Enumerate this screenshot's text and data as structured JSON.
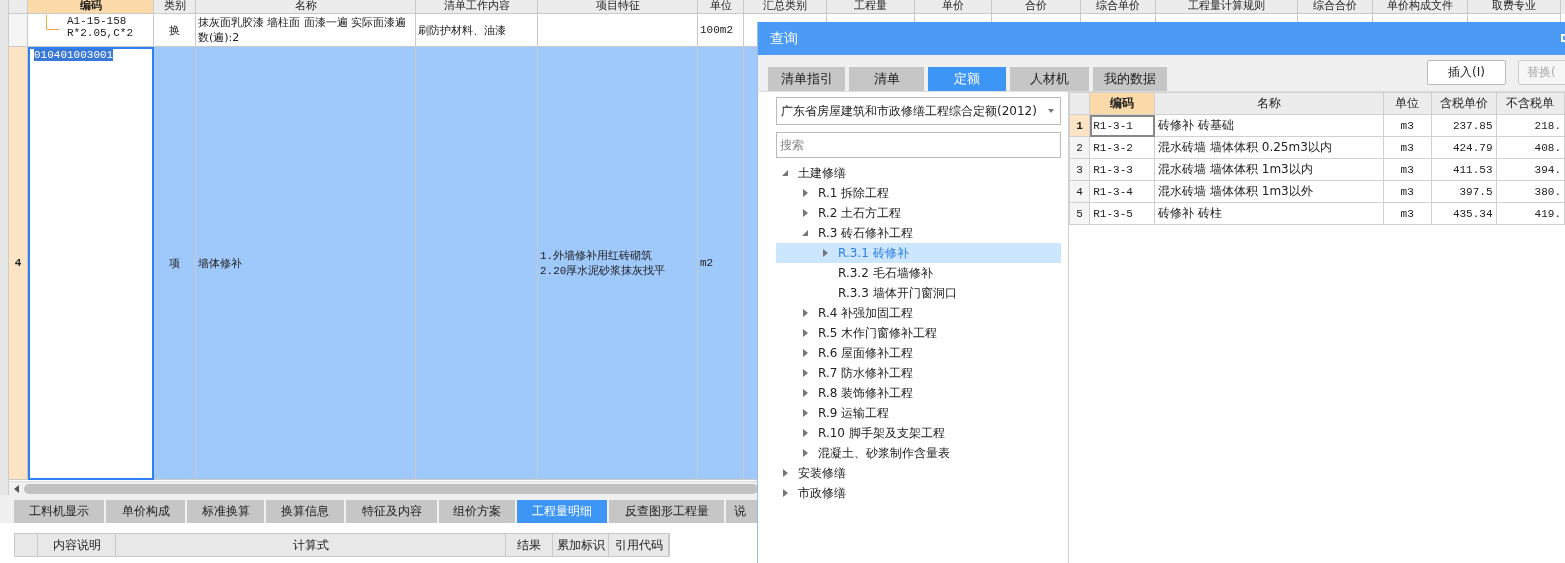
{
  "main_grid": {
    "columns": [
      "编码",
      "类别",
      "名称",
      "清单工作内容",
      "项目特征",
      "单位",
      "汇总类别",
      "工程量",
      "单价",
      "合价",
      "综合单价",
      "工程量计算规则",
      "综合合价",
      "单价构成文件",
      "取费专业"
    ],
    "rows": [
      {
        "kind": "sub",
        "row_number": "",
        "selected": false,
        "cells": [
          "A1-15-158 R*2.05,C*2",
          "换",
          "抹灰面乳胶漆 墙柱面 面漆一遍  实际面漆遍数(遍):2",
          "刷防护材料、油漆",
          "",
          "100m2"
        ]
      },
      {
        "kind": "item",
        "row_number": "4",
        "selected": true,
        "cells": [
          "010401003001",
          "项",
          "墙体修补",
          "",
          "1.外墙修补用红砖砌筑\n2.20厚水泥砂浆抹灰找平",
          "m2"
        ]
      }
    ]
  },
  "bottom_panel": {
    "tabs": [
      {
        "label": "工料机显示",
        "selected": false
      },
      {
        "label": "单价构成",
        "selected": false
      },
      {
        "label": "标准换算",
        "selected": false
      },
      {
        "label": "换算信息",
        "selected": false
      },
      {
        "label": "特征及内容",
        "selected": false
      },
      {
        "label": "组价方案",
        "selected": false
      },
      {
        "label": "工程量明细",
        "selected": true
      },
      {
        "label": "反查图形工程量",
        "selected": false
      },
      {
        "label": "说",
        "selected": false
      }
    ],
    "table": {
      "columns": [
        "内容说明",
        "计算式",
        "结果",
        "累加标识",
        "引用代码"
      ]
    }
  },
  "dialog": {
    "title": "查询",
    "tabs": [
      {
        "label": "清单指引",
        "selected": false
      },
      {
        "label": "清单",
        "selected": false
      },
      {
        "label": "定额",
        "selected": true
      },
      {
        "label": "人材机",
        "selected": false
      },
      {
        "label": "我的数据",
        "selected": false
      }
    ],
    "buttons": [
      {
        "label": "插入(I)",
        "disabled": false
      },
      {
        "label": "替换(",
        "disabled": true
      }
    ],
    "library": "广东省房屋建筑和市政修缮工程综合定额(2012)",
    "search": {
      "placeholder": "搜索"
    },
    "tree": [
      {
        "label": "土建修缮",
        "expanded": true,
        "selected": false,
        "children": [
          {
            "label": "R.1 拆除工程",
            "expanded": false,
            "selected": false
          },
          {
            "label": "R.2 土石方工程",
            "expanded": false,
            "selected": false
          },
          {
            "label": "R.3 砖石修补工程",
            "expanded": true,
            "selected": false,
            "children": [
              {
                "label": "R.3.1 砖修补",
                "expanded": false,
                "selected": true
              },
              {
                "label": "R.3.2 毛石墙修补",
                "selected": false
              },
              {
                "label": "R.3.3 墙体开门窗洞口",
                "selected": false
              }
            ]
          },
          {
            "label": "R.4 补强加固工程",
            "expanded": false,
            "selected": false
          },
          {
            "label": "R.5 木作门窗修补工程",
            "expanded": false,
            "selected": false
          },
          {
            "label": "R.6 屋面修补工程",
            "expanded": false,
            "selected": false
          },
          {
            "label": "R.7 防水修补工程",
            "expanded": false,
            "selected": false
          },
          {
            "label": "R.8 装饰修补工程",
            "expanded": false,
            "selected": false
          },
          {
            "label": "R.9 运输工程",
            "expanded": false,
            "selected": false
          },
          {
            "label": "R.10 脚手架及支架工程",
            "expanded": false,
            "selected": false
          },
          {
            "label": "混凝土、砂浆制作含量表",
            "expanded": false,
            "selected": false
          }
        ]
      },
      {
        "label": "安装修缮",
        "expanded": false,
        "selected": false
      },
      {
        "label": "市政修缮",
        "expanded": false,
        "selected": false
      }
    ],
    "table": {
      "columns": [
        "编码",
        "名称",
        "单位",
        "含税单价",
        "不含税单"
      ],
      "rows": [
        {
          "row_number": "1",
          "selected": true,
          "cells": [
            "R1-3-1",
            "砖修补 砖基础",
            "m3",
            "237.85",
            "218."
          ]
        },
        {
          "row_number": "2",
          "selected": false,
          "cells": [
            "R1-3-2",
            "混水砖墙 墙体体积 0.25m3以内",
            "m3",
            "424.79",
            "408."
          ]
        },
        {
          "row_number": "3",
          "selected": false,
          "cells": [
            "R1-3-3",
            "混水砖墙 墙体体积 1m3以内",
            "m3",
            "411.53",
            "394."
          ]
        },
        {
          "row_number": "4",
          "selected": false,
          "cells": [
            "R1-3-4",
            "混水砖墙 墙体体积 1m3以外",
            "m3",
            "397.5",
            "380."
          ]
        },
        {
          "row_number": "5",
          "selected": false,
          "cells": [
            "R1-3-5",
            "砖修补 砖柱",
            "m3",
            "435.34",
            "419."
          ]
        }
      ]
    }
  }
}
